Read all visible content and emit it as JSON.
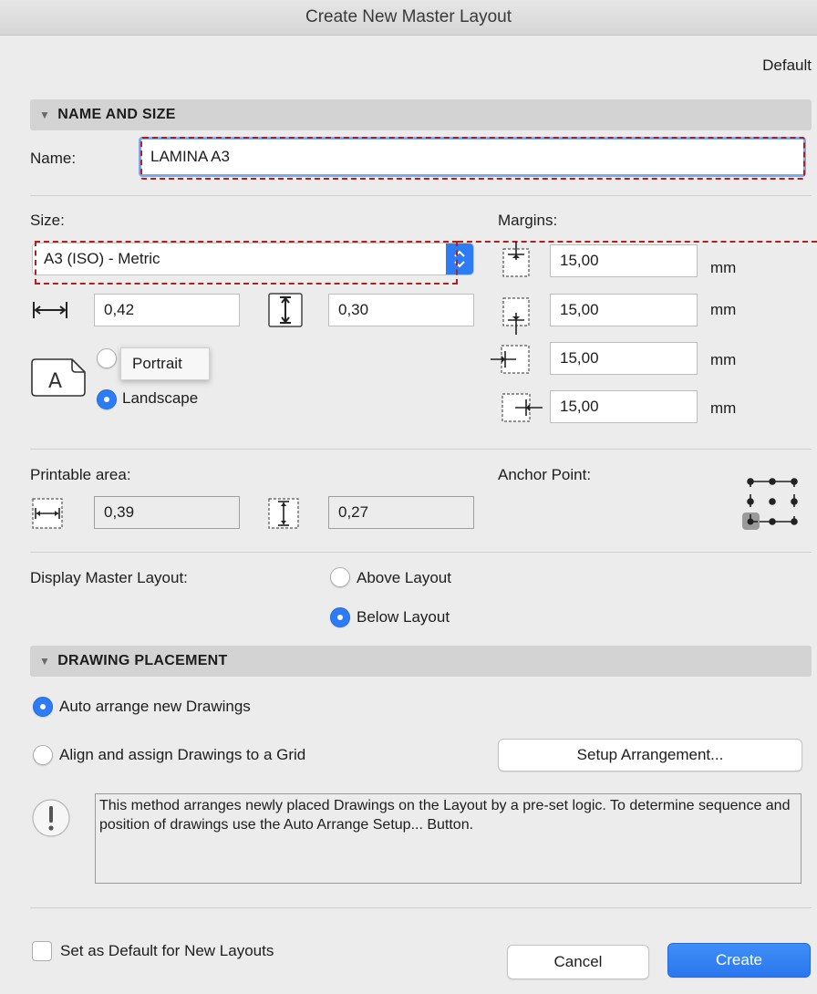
{
  "window": {
    "title": "Create New Master Layout"
  },
  "profile_label": "Default",
  "sections": {
    "name_size": "NAME AND SIZE",
    "drawing_placement": "DRAWING PLACEMENT"
  },
  "name": {
    "label": "Name:",
    "value": "LAMINA A3"
  },
  "size": {
    "label": "Size:",
    "selected": "A3 (ISO) - Metric",
    "width": "0,42",
    "height": "0,30"
  },
  "orientation": {
    "portrait_label": "Portrait",
    "landscape_label": "Landscape",
    "selected": "landscape"
  },
  "margins": {
    "label": "Margins:",
    "top": "15,00",
    "bottom": "15,00",
    "left": "15,00",
    "right": "15,00",
    "unit": "mm"
  },
  "printable": {
    "label": "Printable area:",
    "width": "0,39",
    "height": "0,27"
  },
  "anchor": {
    "label": "Anchor Point:",
    "selected": "bottom-left"
  },
  "display_master": {
    "label": "Display Master Layout:",
    "above_label": "Above Layout",
    "below_label": "Below Layout",
    "selected": "below"
  },
  "placement": {
    "auto_label": "Auto arrange new Drawings",
    "grid_label": "Align and assign Drawings to a Grid",
    "selected": "auto",
    "setup_button": "Setup Arrangement...",
    "info_text": "This method arranges newly placed Drawings on the Layout by a pre-set logic. To determine sequence and position of drawings use the Auto Arrange Setup... Button."
  },
  "footer": {
    "default_checkbox_label": "Set as Default for New Layouts",
    "cancel": "Cancel",
    "create": "Create"
  },
  "colors": {
    "accent": "#2d7cf6",
    "highlight_dash": "#b0201e",
    "background": "#ececec"
  }
}
